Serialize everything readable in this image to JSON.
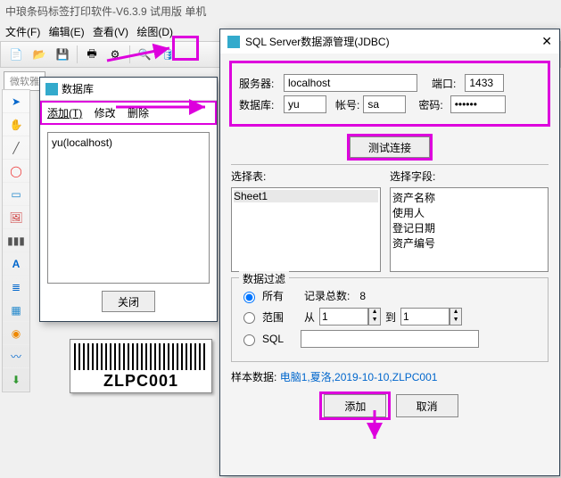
{
  "app_title": "中琅条码标签打印软件-V6.3.9 试用版 单机",
  "menu": {
    "file": "文件(F)",
    "edit": "编辑(E)",
    "view": "查看(V)",
    "draw": "绘图(D)"
  },
  "tab": "微软雅",
  "barcode_text": "ZLPC001",
  "dlg1": {
    "title": "数据库",
    "add": "添加(T)",
    "modify": "修改",
    "delete": "删除",
    "entry": "yu(localhost)",
    "close": "关闭"
  },
  "dlg2": {
    "title": "SQL Server数据源管理(JDBC)",
    "server_label": "服务器:",
    "server": "localhost",
    "port_label": "端口:",
    "port": "1433",
    "db_label": "数据库:",
    "db": "yu",
    "acct_label": "帐号:",
    "acct": "sa",
    "pwd_label": "密码:",
    "pwd": "••••••",
    "test": "测试连接",
    "sel_table": "选择表:",
    "sel_field": "选择字段:",
    "table": "Sheet1",
    "fields": [
      "资产名称",
      "使用人",
      "登记日期",
      "资产编号"
    ],
    "filter_legend": "数据过滤",
    "all": "所有",
    "count_label": "记录总数:",
    "count": "8",
    "range": "范围",
    "from": "从",
    "to": "到",
    "from_v": "1",
    "to_v": "1",
    "sql": "SQL",
    "sample_label": "样本数据:",
    "sample": "电脑1,夏洛,2019-10-10,ZLPC001",
    "add": "添加",
    "cancel": "取消"
  }
}
